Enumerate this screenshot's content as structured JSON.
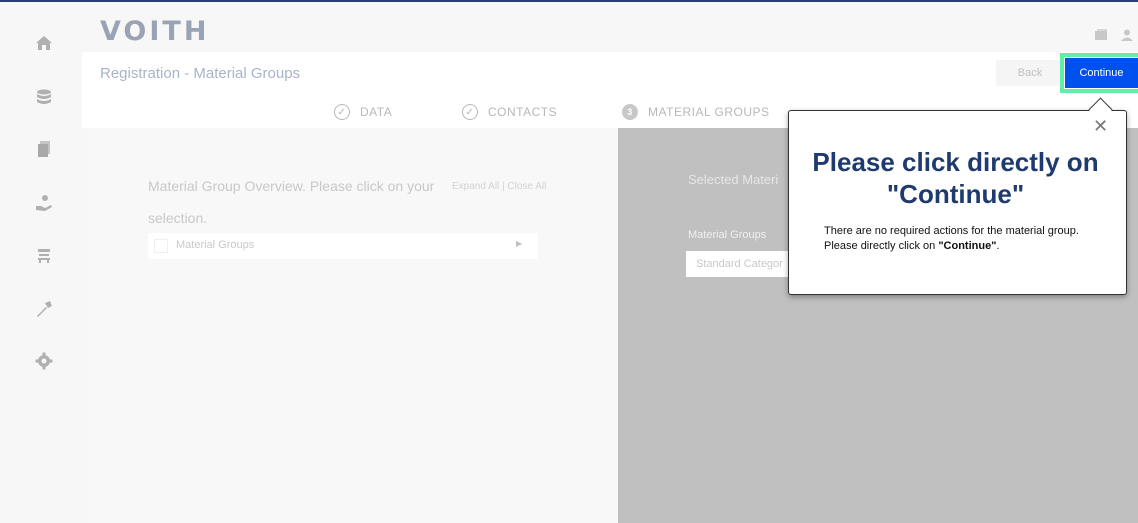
{
  "brand": {
    "logo": "VOITH"
  },
  "page": {
    "title": "Registration - Material Groups"
  },
  "actions": {
    "back": "Back",
    "continue": "Continue"
  },
  "steps": [
    {
      "label": "DATA"
    },
    {
      "label": "CONTACTS"
    },
    {
      "number": "3",
      "label": "MATERIAL GROUPS"
    }
  ],
  "left": {
    "overview": "Material Group Overview. Please click on your selection.",
    "expand": "Expand All | Close All",
    "material_groups": "Material Groups"
  },
  "right": {
    "selected_title": "Selected Materi",
    "material_groups_label": "Material Groups",
    "standard_category_value": "Standard Categor"
  },
  "popup": {
    "title": "Please click directly on \"Continue\"",
    "text_before": "There are no required actions for the material group. Please directly click on ",
    "text_bold": "\"Continue\"",
    "text_after": "."
  },
  "sidebar_icons": [
    "home-icon",
    "database-icon",
    "documents-icon",
    "supplier-icon",
    "cart-icon",
    "tools-icon",
    "settings-icon"
  ],
  "colors": {
    "primary": "#0050f0",
    "highlight": "#5ff0a7",
    "popup_title": "#1f3a6e"
  }
}
